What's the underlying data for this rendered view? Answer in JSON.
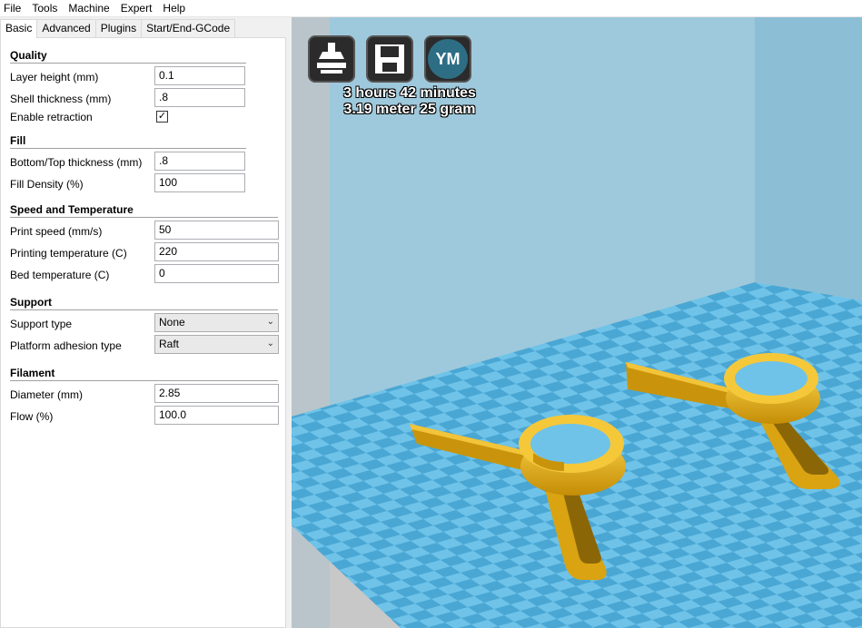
{
  "menu": [
    "File",
    "Tools",
    "Machine",
    "Expert",
    "Help"
  ],
  "tabs": [
    "Basic",
    "Advanced",
    "Plugins",
    "Start/End-GCode"
  ],
  "sections": {
    "quality": "Quality",
    "fill": "Fill",
    "speed": "Speed and Temperature",
    "support": "Support",
    "filament": "Filament"
  },
  "fields": {
    "layer_height": {
      "label": "Layer height (mm)",
      "value": "0.1"
    },
    "shell_thickness": {
      "label": "Shell thickness (mm)",
      "value": ".8"
    },
    "enable_retraction": {
      "label": "Enable retraction",
      "checked": true
    },
    "bottom_top": {
      "label": "Bottom/Top thickness (mm)",
      "value": ".8"
    },
    "fill_density": {
      "label": "Fill Density (%)",
      "value": "100"
    },
    "print_speed": {
      "label": "Print speed (mm/s)",
      "value": "50"
    },
    "print_temp": {
      "label": "Printing temperature (C)",
      "value": "220"
    },
    "bed_temp": {
      "label": "Bed temperature (C)",
      "value": "0"
    },
    "support_type": {
      "label": "Support type",
      "value": "None"
    },
    "adhesion": {
      "label": "Platform adhesion type",
      "value": "Raft"
    },
    "diameter": {
      "label": "Diameter (mm)",
      "value": "2.85"
    },
    "flow": {
      "label": "Flow (%)",
      "value": "100.0"
    }
  },
  "viewport": {
    "print_time": "3 hours 42 minutes",
    "material": "3.19 meter 25 gram",
    "ym_label": "YM",
    "icons": [
      "load-model-icon",
      "save-icon",
      "view-mode-icon"
    ]
  },
  "colors": {
    "wall": "#9ec9dc",
    "floor_light": "#6fc3e8",
    "floor_dark": "#4aa7d4",
    "model": "#e8b11a"
  }
}
